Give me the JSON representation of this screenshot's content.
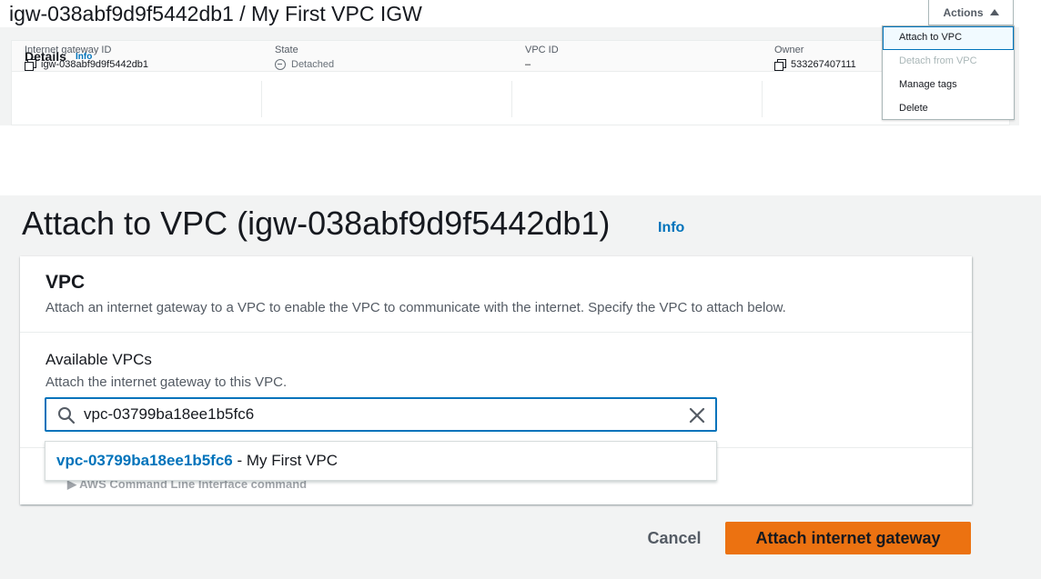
{
  "igw_page": {
    "title": "igw-038abf9d9f5442db1 / My First VPC IGW",
    "details": {
      "title": "Details",
      "info": "Info",
      "fields": [
        {
          "label": "Internet gateway ID",
          "value": "igw-038abf9d9f5442db1",
          "icon": "copy-icon"
        },
        {
          "label": "State",
          "value": "Detached",
          "icon": "detached-icon"
        },
        {
          "label": "VPC ID",
          "value": "–"
        },
        {
          "label": "Owner",
          "value": "533267407111",
          "icon": "copy-icon"
        }
      ]
    },
    "actions": {
      "label": "Actions",
      "menu": [
        {
          "label": "Attach to VPC",
          "state": "active"
        },
        {
          "label": "Detach from VPC",
          "state": "disabled"
        },
        {
          "label": "Manage tags",
          "state": "enabled"
        },
        {
          "label": "Delete",
          "state": "enabled"
        }
      ]
    }
  },
  "attach_page": {
    "title": "Attach to VPC (igw-038abf9d9f5442db1)",
    "info": "Info",
    "card": {
      "title": "VPC",
      "description": "Attach an internet gateway to a VPC to enable the VPC to communicate with the internet. Specify the VPC to attach below.",
      "field_label": "Available VPCs",
      "field_description": "Attach the internet gateway to this VPC.",
      "search_value": "vpc-03799ba18ee1b5fc6",
      "dropdown_option": {
        "id": "vpc-03799ba18ee1b5fc6",
        "name": " - My First VPC"
      },
      "hidden_section": "AWS Command Line Interface command"
    },
    "buttons": {
      "cancel": "Cancel",
      "primary": "Attach internet gateway"
    }
  },
  "colors": {
    "link": "#0073bb",
    "primary": "#ec7211",
    "page_bg": "#f2f3f3"
  }
}
